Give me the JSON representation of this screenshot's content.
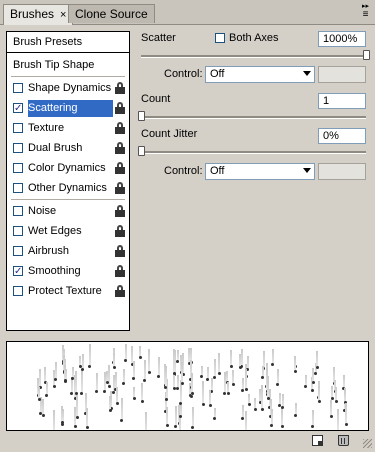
{
  "tabs": [
    {
      "label": "Brushes"
    },
    {
      "label": "Clone Source"
    }
  ],
  "tab_close": "×",
  "flyout_glyph": "≡",
  "presets_label": "Brush Presets",
  "tip_shape_label": "Brush Tip Shape",
  "options": [
    {
      "label": "Shape Dynamics",
      "checked": false,
      "selected": false
    },
    {
      "label": "Scattering",
      "checked": true,
      "selected": true
    },
    {
      "label": "Texture",
      "checked": false,
      "selected": false
    },
    {
      "label": "Dual Brush",
      "checked": false,
      "selected": false
    },
    {
      "label": "Color Dynamics",
      "checked": false,
      "selected": false
    },
    {
      "label": "Other Dynamics",
      "checked": false,
      "selected": false
    },
    {
      "label": "Noise",
      "checked": false,
      "selected": false
    },
    {
      "label": "Wet Edges",
      "checked": false,
      "selected": false
    },
    {
      "label": "Airbrush",
      "checked": false,
      "selected": false
    },
    {
      "label": "Smoothing",
      "checked": true,
      "selected": false
    },
    {
      "label": "Protect Texture",
      "checked": false,
      "selected": false
    }
  ],
  "check_glyph": "✓",
  "scatter": {
    "label": "Scatter",
    "both_axes_label": "Both Axes",
    "both_axes_checked": false,
    "value": "1000%",
    "slider_fraction": 1.0
  },
  "control1": {
    "label": "Control:",
    "value": "Off"
  },
  "count": {
    "label": "Count",
    "value": "1",
    "slider_fraction": 0.0
  },
  "count_jitter": {
    "label": "Count Jitter",
    "value": "0%",
    "slider_fraction": 0.0
  },
  "control2": {
    "label": "Control:",
    "value": "Off"
  },
  "colors": {
    "selection": "#316ac5",
    "panel": "#d4d0c8"
  },
  "icons": [
    "lock-icon",
    "flyout-menu-icon",
    "new-brush-icon",
    "trash-icon",
    "dropdown-arrow-icon"
  ]
}
